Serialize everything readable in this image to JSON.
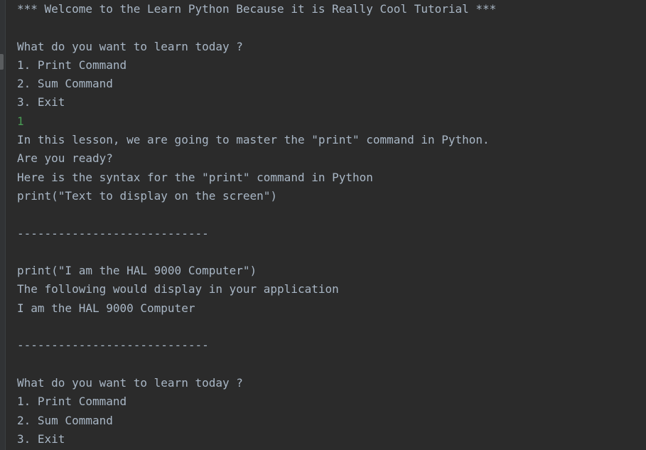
{
  "console": {
    "lines": [
      {
        "text": "*** Welcome to the Learn Python Because it is Really Cool Tutorial ***",
        "kind": "output"
      },
      {
        "text": "",
        "kind": "blank"
      },
      {
        "text": "What do you want to learn today ?",
        "kind": "output"
      },
      {
        "text": "1. Print Command",
        "kind": "output"
      },
      {
        "text": "2. Sum Command",
        "kind": "output"
      },
      {
        "text": "3. Exit",
        "kind": "output"
      },
      {
        "text": "1",
        "kind": "input"
      },
      {
        "text": "In this lesson, we are going to master the \"print\" command in Python.",
        "kind": "output"
      },
      {
        "text": "Are you ready?",
        "kind": "output"
      },
      {
        "text": "Here is the syntax for the \"print\" command in Python",
        "kind": "output"
      },
      {
        "text": "print(\"Text to display on the screen\")",
        "kind": "output"
      },
      {
        "text": "",
        "kind": "blank"
      },
      {
        "text": "----------------------------",
        "kind": "output"
      },
      {
        "text": "",
        "kind": "blank"
      },
      {
        "text": "print(\"I am the HAL 9000 Computer\")",
        "kind": "output"
      },
      {
        "text": "The following would display in your application",
        "kind": "output"
      },
      {
        "text": "I am the HAL 9000 Computer",
        "kind": "output"
      },
      {
        "text": "",
        "kind": "blank"
      },
      {
        "text": "----------------------------",
        "kind": "output"
      },
      {
        "text": "",
        "kind": "blank"
      },
      {
        "text": "What do you want to learn today ?",
        "kind": "output"
      },
      {
        "text": "1. Print Command",
        "kind": "output"
      },
      {
        "text": "2. Sum Command",
        "kind": "output"
      },
      {
        "text": "3. Exit",
        "kind": "output"
      }
    ]
  },
  "colors": {
    "background": "#2b2b2b",
    "text": "#a9b7c6",
    "user_input": "#499c54"
  }
}
